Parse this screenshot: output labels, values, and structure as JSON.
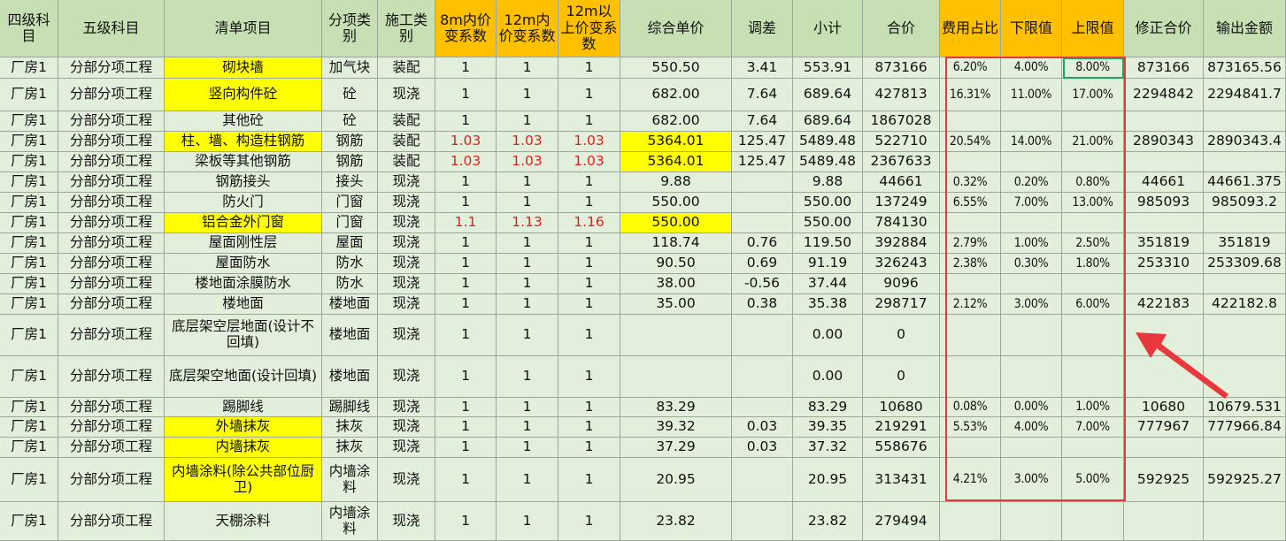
{
  "headers": [
    "四级科目",
    "五级科目",
    "清单项目",
    "分项类别",
    "施工类别",
    "8m内价变系数",
    "12m内价变系数",
    "12m以上价变系数",
    "综合单价",
    "调差",
    "小计",
    "合价",
    "费用占比",
    "下限值",
    "上限值",
    "修正合价",
    "输出金额"
  ],
  "rows": [
    [
      "厂房1",
      "分部分项工程",
      "砌块墙",
      "加气块",
      "装配",
      "1",
      "1",
      "1",
      "550.50",
      "3.41",
      "553.91",
      "873166",
      "6.20%",
      "4.00%",
      "8.00%",
      "873166",
      "873165.56"
    ],
    [
      "厂房1",
      "分部分项工程",
      "竖向构件砼",
      "砼",
      "现浇",
      "1",
      "1",
      "1",
      "682.00",
      "7.64",
      "689.64",
      "427813",
      "16.31%",
      "11.00%",
      "17.00%",
      "2294842",
      "2294841.7"
    ],
    [
      "厂房1",
      "分部分项工程",
      "其他砼",
      "砼",
      "装配",
      "1",
      "1",
      "1",
      "682.00",
      "7.64",
      "689.64",
      "1867028",
      "",
      "",
      "",
      "",
      ""
    ],
    [
      "厂房1",
      "分部分项工程",
      "柱、墙、构造柱钢筋",
      "钢筋",
      "装配",
      "1.03",
      "1.03",
      "1.03",
      "5364.01",
      "125.47",
      "5489.48",
      "522710",
      "20.54%",
      "14.00%",
      "21.00%",
      "2890343",
      "2890343.4"
    ],
    [
      "厂房1",
      "分部分项工程",
      "梁板等其他钢筋",
      "钢筋",
      "装配",
      "1.03",
      "1.03",
      "1.03",
      "5364.01",
      "125.47",
      "5489.48",
      "2367633",
      "",
      "",
      "",
      "",
      ""
    ],
    [
      "厂房1",
      "分部分项工程",
      "钢筋接头",
      "接头",
      "现浇",
      "1",
      "1",
      "1",
      "9.88",
      "",
      "9.88",
      "44661",
      "0.32%",
      "0.20%",
      "0.80%",
      "44661",
      "44661.375"
    ],
    [
      "厂房1",
      "分部分项工程",
      "防火门",
      "门窗",
      "现浇",
      "1",
      "1",
      "1",
      "550.00",
      "",
      "550.00",
      "137249",
      "6.55%",
      "7.00%",
      "13.00%",
      "985093",
      "985093.2"
    ],
    [
      "厂房1",
      "分部分项工程",
      "铝合金外门窗",
      "门窗",
      "现浇",
      "1.1",
      "1.13",
      "1.16",
      "550.00",
      "",
      "550.00",
      "784130",
      "",
      "",
      "",
      "",
      ""
    ],
    [
      "厂房1",
      "分部分项工程",
      "屋面刚性层",
      "屋面",
      "现浇",
      "1",
      "1",
      "1",
      "118.74",
      "0.76",
      "119.50",
      "392884",
      "2.79%",
      "1.00%",
      "2.50%",
      "351819",
      "351819"
    ],
    [
      "厂房1",
      "分部分项工程",
      "屋面防水",
      "防水",
      "现浇",
      "1",
      "1",
      "1",
      "90.50",
      "0.69",
      "91.19",
      "326243",
      "2.38%",
      "0.30%",
      "1.80%",
      "253310",
      "253309.68"
    ],
    [
      "厂房1",
      "分部分项工程",
      "楼地面涂膜防水",
      "防水",
      "现浇",
      "1",
      "1",
      "1",
      "38.00",
      "-0.56",
      "37.44",
      "9096",
      "",
      "",
      "",
      "",
      ""
    ],
    [
      "厂房1",
      "分部分项工程",
      "楼地面",
      "楼地面",
      "现浇",
      "1",
      "1",
      "1",
      "35.00",
      "0.38",
      "35.38",
      "298717",
      "2.12%",
      "3.00%",
      "6.00%",
      "422183",
      "422182.8"
    ],
    [
      "厂房1",
      "分部分项工程",
      "底层架空层地面(设计不回填)",
      "楼地面",
      "现浇",
      "1",
      "1",
      "1",
      "",
      "",
      "0.00",
      "0",
      "",
      "",
      "",
      "",
      ""
    ],
    [
      "厂房1",
      "分部分项工程",
      "底层架空地面(设计回填)",
      "楼地面",
      "现浇",
      "1",
      "1",
      "1",
      "",
      "",
      "0.00",
      "0",
      "",
      "",
      "",
      "",
      ""
    ],
    [
      "厂房1",
      "分部分项工程",
      "踢脚线",
      "踢脚线",
      "现浇",
      "1",
      "1",
      "1",
      "83.29",
      "",
      "83.29",
      "10680",
      "0.08%",
      "0.00%",
      "1.00%",
      "10680",
      "10679.531"
    ],
    [
      "厂房1",
      "分部分项工程",
      "外墙抹灰",
      "抹灰",
      "现浇",
      "1",
      "1",
      "1",
      "39.32",
      "0.03",
      "39.35",
      "219291",
      "5.53%",
      "4.00%",
      "7.00%",
      "777967",
      "777966.84"
    ],
    [
      "厂房1",
      "分部分项工程",
      "内墙抹灰",
      "抹灰",
      "现浇",
      "1",
      "1",
      "1",
      "37.29",
      "0.03",
      "37.32",
      "558676",
      "",
      "",
      "",
      "",
      ""
    ],
    [
      "厂房1",
      "分部分项工程",
      "内墙涂料(除公共部位厨卫)",
      "内墙涂料",
      "现浇",
      "1",
      "1",
      "1",
      "20.95",
      "",
      "20.95",
      "313431",
      "4.21%",
      "3.00%",
      "5.00%",
      "592925",
      "592925.27"
    ],
    [
      "厂房1",
      "分部分项工程",
      "天棚涂料",
      "内墙涂料",
      "现浇",
      "1",
      "1",
      "1",
      "23.82",
      "",
      "23.82",
      "279494",
      "",
      "",
      "",
      "",
      ""
    ]
  ],
  "colors": {
    "header_green": "#c6e0b4",
    "header_orange": "#ffc000",
    "body_green": "#e2efda",
    "highlight_yellow": "#ffff00",
    "red_text": "#e02020",
    "annotation_red": "#e8383d",
    "selection_green": "#21a366"
  },
  "icons": [
    "red-arrow-icon"
  ]
}
